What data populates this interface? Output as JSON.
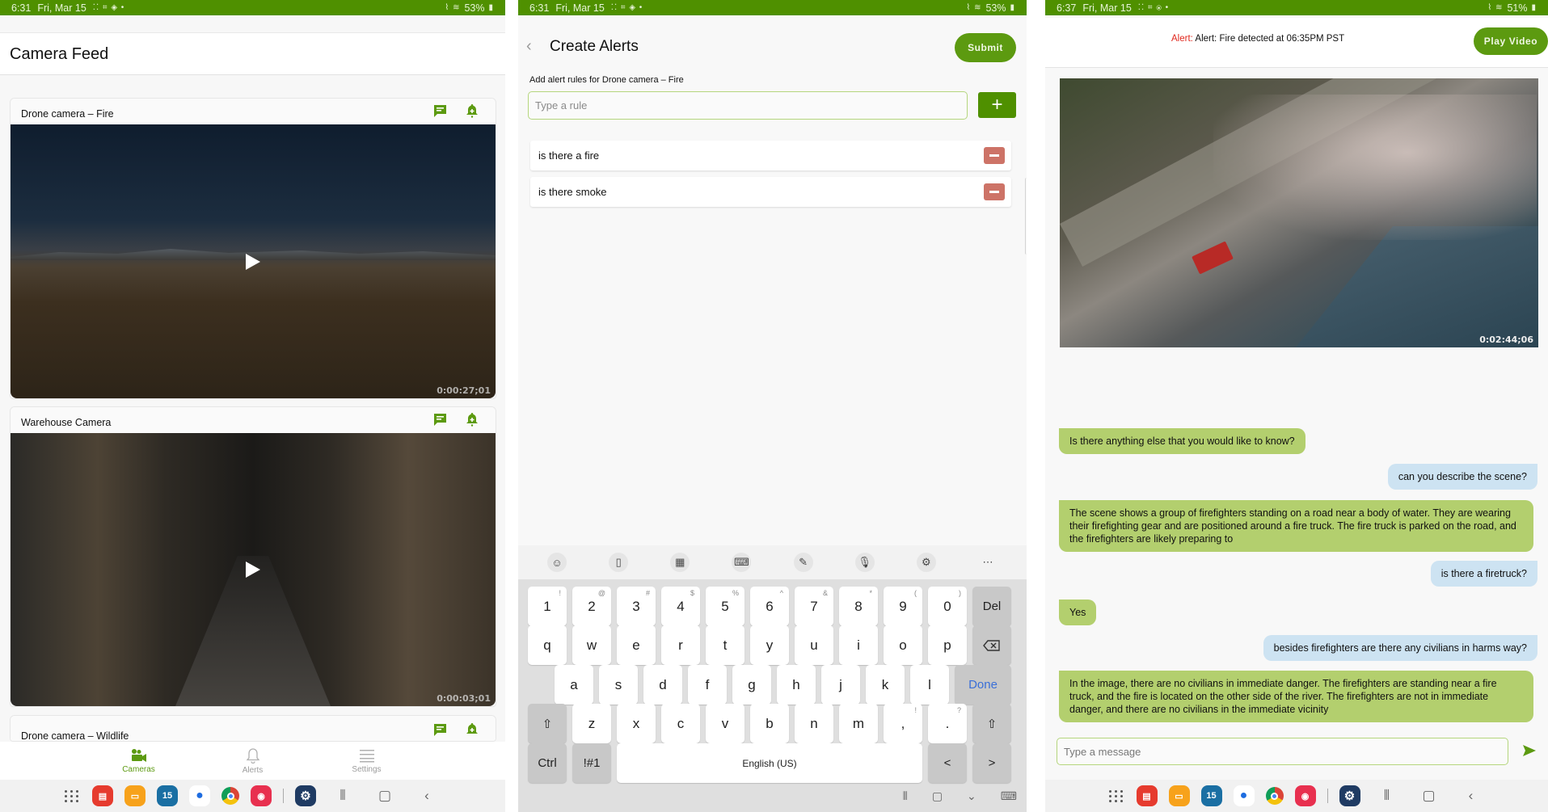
{
  "panels": {
    "camera_feed": {
      "status": {
        "time": "6:31",
        "date": "Fri, Mar 15",
        "battery": "53%"
      },
      "title": "Camera Feed",
      "cards": [
        {
          "label": "Drone camera – Fire",
          "timecode": "0:00:27;01"
        },
        {
          "label": "Warehouse Camera",
          "timecode": "0:00:03;01"
        },
        {
          "label": "Drone camera – Wildlife"
        }
      ],
      "bottom_nav": [
        {
          "label": "Cameras",
          "icon": "camera-icon",
          "active": true
        },
        {
          "label": "Alerts",
          "icon": "bell-icon",
          "active": false
        },
        {
          "label": "Settings",
          "icon": "menu-icon",
          "active": false
        }
      ]
    },
    "create_alerts": {
      "status": {
        "time": "6:31",
        "date": "Fri, Mar 15",
        "battery": "53%"
      },
      "title": "Create Alerts",
      "submit_label": "Submit",
      "rules_label": "Add alert rules for Drone camera – Fire",
      "rule_input": {
        "value": "",
        "placeholder": "Type a rule"
      },
      "add_label": "+",
      "rules": [
        "is there a fire",
        "is there smoke"
      ],
      "keyboard": {
        "number_row": [
          {
            "k": "1",
            "alt": "!"
          },
          {
            "k": "2",
            "alt": "@"
          },
          {
            "k": "3",
            "alt": "#"
          },
          {
            "k": "4",
            "alt": "$"
          },
          {
            "k": "5",
            "alt": "%"
          },
          {
            "k": "6",
            "alt": "^"
          },
          {
            "k": "7",
            "alt": "&"
          },
          {
            "k": "8",
            "alt": "*"
          },
          {
            "k": "9",
            "alt": "("
          },
          {
            "k": "0",
            "alt": ")"
          }
        ],
        "del_label": "Del",
        "row_q": [
          "q",
          "w",
          "e",
          "r",
          "t",
          "y",
          "u",
          "i",
          "o",
          "p"
        ],
        "row_a": [
          "a",
          "s",
          "d",
          "f",
          "g",
          "h",
          "j",
          "k",
          "l"
        ],
        "done_label": "Done",
        "row_z": [
          "z",
          "x",
          "c",
          "v",
          "b",
          "n",
          "m"
        ],
        "comma": {
          "k": ",",
          "alt": "!"
        },
        "period": {
          "k": ".",
          "alt": "?"
        },
        "ctrl_label": "Ctrl",
        "sym_label": "!#1",
        "space_label": "English (US)",
        "left_label": "<",
        "right_label": ">"
      }
    },
    "alert_chat": {
      "status": {
        "time": "6:37",
        "date": "Fri, Mar 15",
        "battery": "51%"
      },
      "alert_prefix": "Alert:",
      "alert_message": "Alert: Fire detected at 06:35PM PST",
      "play_video_label": "Play Video",
      "timecode": "0:02:44;06",
      "messages": [
        {
          "role": "bot",
          "text": "Is there anything else that you would like to know?"
        },
        {
          "role": "user",
          "text": "can you describe the scene?"
        },
        {
          "role": "bot",
          "text": "The scene shows a group of firefighters standing on a road near a body of water. They are wearing their firefighting gear and are positioned around a fire truck. The fire truck is parked on the road, and the firefighters are likely preparing to"
        },
        {
          "role": "user",
          "text": "is there a firetruck?"
        },
        {
          "role": "bot",
          "text": "Yes"
        },
        {
          "role": "user",
          "text": "besides firefighters are there any civilians in harms way?"
        },
        {
          "role": "bot",
          "text": "In the image, there are no civilians in immediate danger. The firefighters are standing near a fire truck, and the fire is located on the other side of the river. The firefighters are not in immediate danger, and there are no civilians in the immediate vicinity"
        }
      ],
      "message_input": {
        "value": "",
        "placeholder": "Type a message"
      }
    }
  },
  "taskbar": {
    "apps": [
      {
        "name": "notes-app-icon",
        "color": "#e63b2e"
      },
      {
        "name": "files-app-icon",
        "color": "#f7a21b"
      },
      {
        "name": "calendar-app-icon",
        "color": "#1a6fa3",
        "label": "15"
      },
      {
        "name": "messages-app-icon",
        "color": "#ffffff"
      },
      {
        "name": "chrome-app-icon",
        "color": "#ffffff"
      },
      {
        "name": "camera-app-icon",
        "color": "#e8304f"
      },
      {
        "name": "settings-app-icon",
        "color": "#1f3b63"
      }
    ]
  },
  "colors": {
    "brand_green": "#5c9a10",
    "status_green": "#4f9000",
    "bot_bubble": "#b3cf6e",
    "user_bubble": "#cde3f2",
    "remove_red": "#cd7367",
    "alert_red": "#e0271d"
  }
}
